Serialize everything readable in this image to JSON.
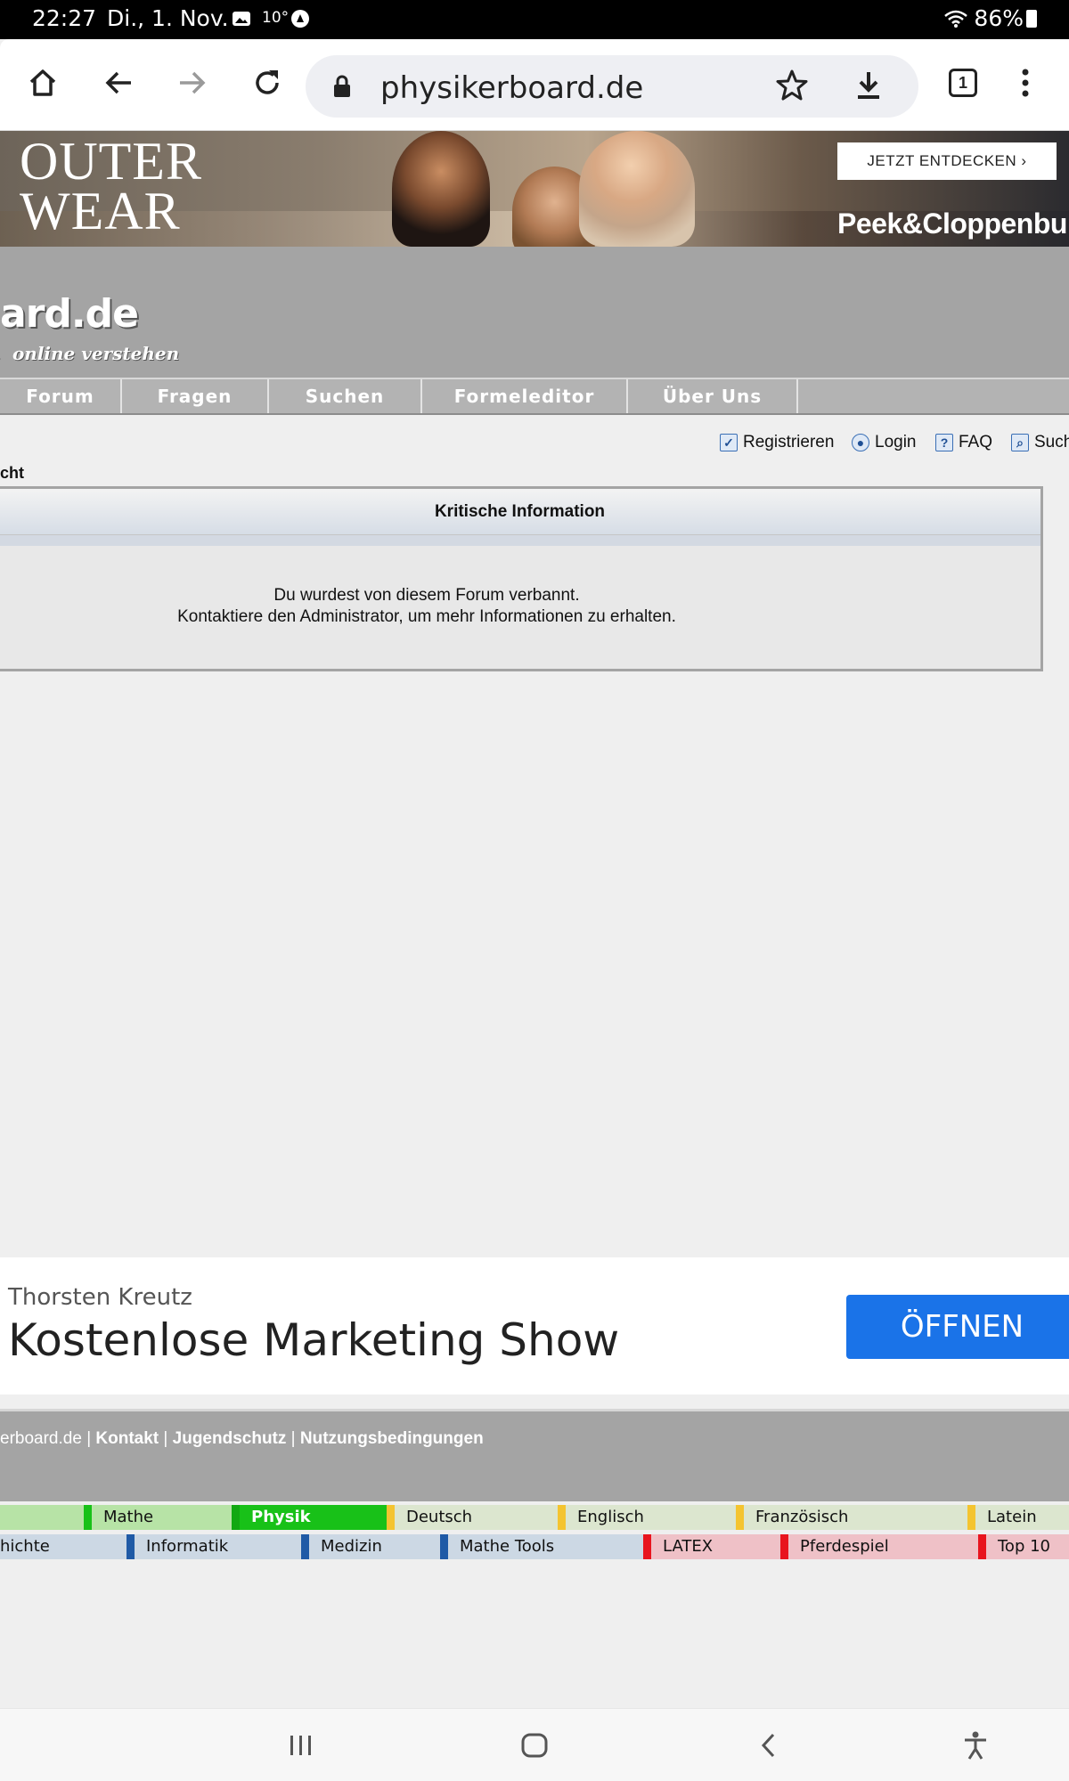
{
  "status_bar": {
    "time": "22:27",
    "date": "Di., 1. Nov.",
    "temperature": "10°",
    "battery": "86%",
    "icons": [
      "image-icon",
      "alert-icon",
      "wifi-icon",
      "battery-icon"
    ]
  },
  "browser": {
    "url": "physikerboard.de",
    "tab_count": "1",
    "icons": [
      "home-icon",
      "back-icon",
      "forward-icon",
      "reload-icon",
      "lock-icon",
      "star-icon",
      "download-icon",
      "tabs-icon",
      "menu-icon"
    ]
  },
  "ad_banner": {
    "headline_line1": "OUTER",
    "headline_line2": "WEAR",
    "cta": "JETZT ENTDECKEN ›",
    "brand": "Peek&Cloppenburg"
  },
  "site": {
    "logo_text": "ard.de",
    "logo_tagline": "online verstehen",
    "nav": [
      "Forum",
      "Fragen",
      "Suchen",
      "Formeleditor",
      "Über Uns"
    ]
  },
  "toolbar": {
    "links": [
      "Registrieren",
      "Login",
      "FAQ",
      "Such"
    ],
    "breadcrumb": "cht"
  },
  "panel": {
    "title": "Kritische Information",
    "line1": "Du wurdest von diesem Forum verbannt.",
    "line2": "Kontaktiere den Administrator, um mehr Informationen zu erhalten."
  },
  "app_ad": {
    "advertiser": "Thorsten Kreutz",
    "title": "Kostenlose Marketing Show",
    "button": "ÖFFNEN"
  },
  "footer": {
    "site_fragment": "erboard.de",
    "links": [
      "Kontakt",
      "Jugendschutz",
      "Nutzungsbedingungen"
    ],
    "separator": "|"
  },
  "subjects": {
    "row1": [
      "Mathe",
      "Physik",
      "Deutsch",
      "Englisch",
      "Französisch",
      "Latein"
    ],
    "row2": [
      "hichte",
      "Informatik",
      "Medizin",
      "Mathe Tools",
      "LATEX",
      "Pferdespiel",
      "Top 10"
    ]
  },
  "colors": {
    "header_gray": "#a4a4a4",
    "physik_green": "#18c118",
    "mathe_green": "#b7e3a6",
    "open_button_blue": "#1a73e8"
  }
}
